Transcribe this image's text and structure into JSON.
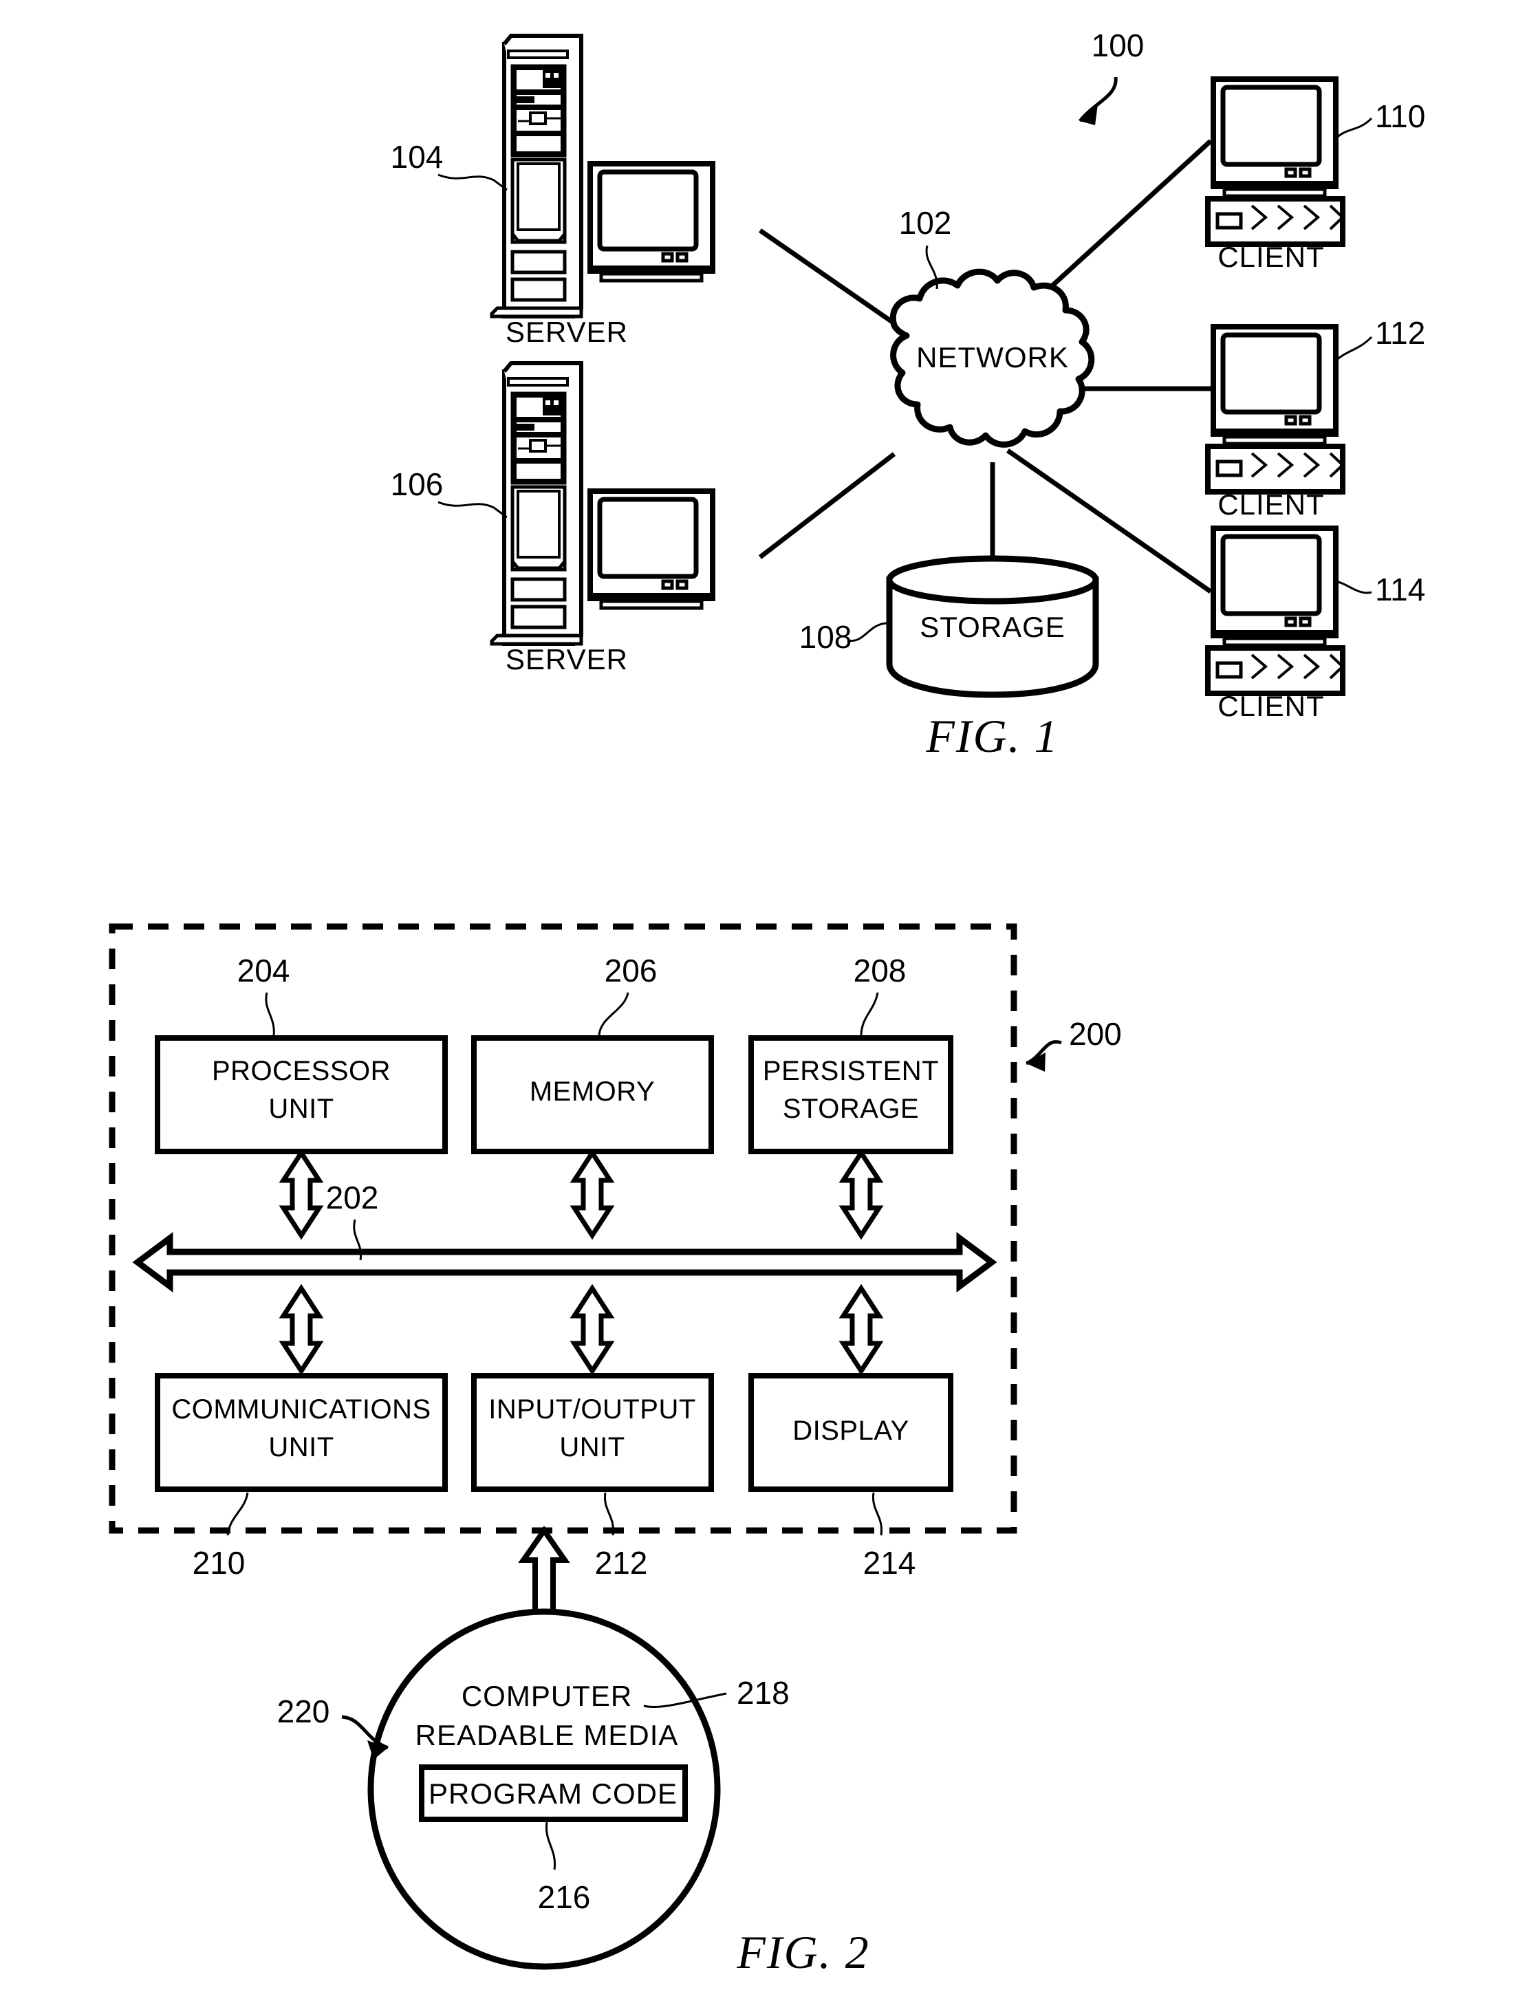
{
  "figure1": {
    "caption": "FIG. 1",
    "system_ref": "100",
    "network": {
      "label": "NETWORK",
      "ref": "102"
    },
    "storage": {
      "label": "STORAGE",
      "ref": "108"
    },
    "servers": [
      {
        "label": "SERVER",
        "ref": "104"
      },
      {
        "label": "SERVER",
        "ref": "106"
      }
    ],
    "clients": [
      {
        "label": "CLIENT",
        "ref": "110"
      },
      {
        "label": "CLIENT",
        "ref": "112"
      },
      {
        "label": "CLIENT",
        "ref": "114"
      }
    ]
  },
  "figure2": {
    "caption": "FIG. 2",
    "data_processing_system_ref": "200",
    "bus": {
      "ref": "202"
    },
    "top_components": [
      {
        "line1": "PROCESSOR",
        "line2": "UNIT",
        "ref": "204"
      },
      {
        "line1": "MEMORY",
        "line2": "",
        "ref": "206"
      },
      {
        "line1": "PERSISTENT",
        "line2": "STORAGE",
        "ref": "208"
      }
    ],
    "bottom_components": [
      {
        "line1": "COMMUNICATIONS",
        "line2": "UNIT",
        "ref": "210"
      },
      {
        "line1": "INPUT/OUTPUT",
        "line2": "UNIT",
        "ref": "212"
      },
      {
        "line1": "DISPLAY",
        "line2": "",
        "ref": "214"
      }
    ],
    "media": {
      "line1": "COMPUTER",
      "line2": "READABLE MEDIA",
      "media_ref": "218",
      "product_ref": "220",
      "program_code_label": "PROGRAM CODE",
      "program_code_ref": "216"
    }
  },
  "colors": {
    "ink": "#000000",
    "paper": "#ffffff"
  }
}
